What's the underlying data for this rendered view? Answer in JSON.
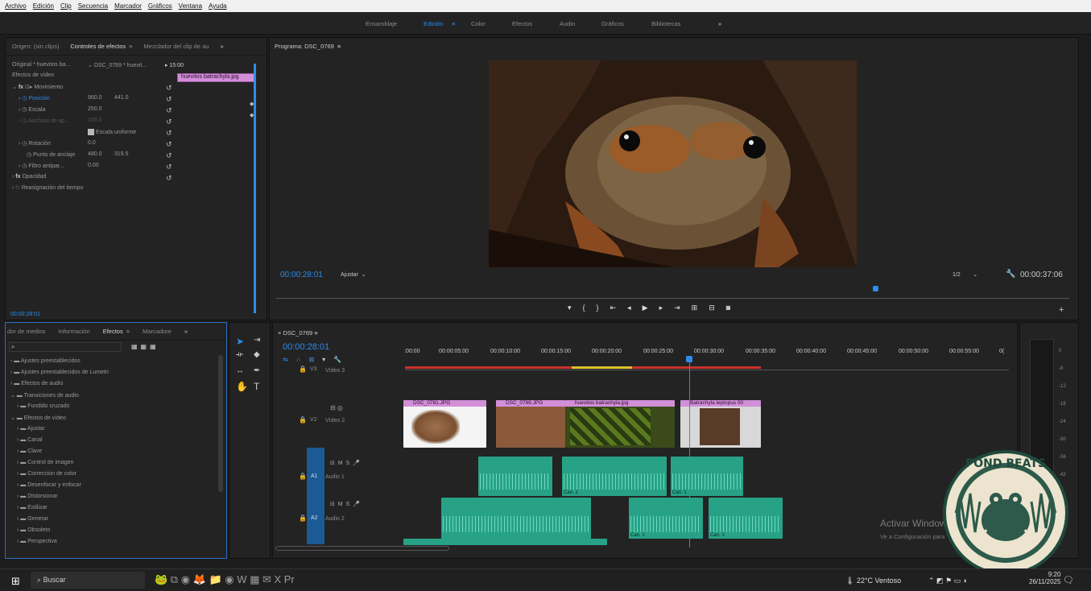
{
  "menubar": {
    "items": [
      "Archivo",
      "Edición",
      "Clip",
      "Secuencia",
      "Marcador",
      "Gráficos",
      "Ventana",
      "Ayuda"
    ]
  },
  "workspaces": {
    "items": [
      "Ensamblaje",
      "Edición",
      "Color",
      "Efectos",
      "Audio",
      "Gráficos",
      "Bibliotecas"
    ],
    "active": "Edición",
    "more": "»"
  },
  "effect_controls": {
    "tabs": [
      "Origen: (sin clips)",
      "Controles de efectos",
      "Mezclador del clip de au"
    ],
    "more": "»",
    "source_label": "Original * huevitos ba...",
    "sequence_label": "DSC_0769 * huevit...",
    "time_head": "15:00",
    "clip_name": "huevitos batrachyla.jpg",
    "section": "Efectos de vídeo",
    "motion": "Movimiento",
    "position_label": "Posición",
    "position_x": "960.0",
    "position_y": "441.0",
    "scale_label": "Escala",
    "scale_value": "250.0",
    "width_label": "Anchura de ap...",
    "width_value": "100.0",
    "uniform_label": "Escala uniforme",
    "rotation_label": "Rotación",
    "rotation_value": "0.0",
    "anchor_label": "Punto de anclaje",
    "anchor_x": "480.0",
    "anchor_y": "319.5",
    "antiflicker_label": "Filtro antipar...",
    "antiflicker_value": "0.00",
    "opacity_label": "Opacidad",
    "timeremap_label": "Reasignación del tiempo",
    "timecode": "00:00:28:01"
  },
  "program": {
    "title": "Programa: DSC_0769",
    "timecode": "00:00:28:01",
    "fit": "Ajustar",
    "resolution": "1/2",
    "duration": "00:00:37:06",
    "playhead_fraction": 0.755
  },
  "effects_panel": {
    "tabs": [
      "dor de medios",
      "Información",
      "Efectos",
      "Marcadore"
    ],
    "more": "»",
    "items": [
      "Ajustes preestablecidos",
      "Ajustes preestablecidos de Lumetri",
      "Efectos de audio",
      "Transiciones de audio",
      "Fundido cruzado",
      "Efectos de vídeo",
      "Ajustar",
      "Canal",
      "Clave",
      "Control de imagen",
      "Corrección de color",
      "Desenfocar y enfocar",
      "Distorsionar",
      "Estilizar",
      "Generar",
      "Obsoleto",
      "Perspectiva"
    ]
  },
  "timeline": {
    "sequence": "DSC_0769",
    "timecode": "00:00:28:01",
    "ruler": [
      ":00:00",
      "00:00:05:00",
      "00:00:10:00",
      "00:00:15:00",
      "00:00:20:00",
      "00:00:25:00",
      "00:00:30:00",
      "00:00:35:00",
      "00:00:40:00",
      "00:00:45:00",
      "00:00:50:00",
      "00:00:55:00",
      "0("
    ],
    "tracks": {
      "v3": "V3",
      "v3_name": "Vídeo 3",
      "v2": "V2",
      "v2_name": "Vídeo 2",
      "a1": "A1",
      "a1_name": "Audio 1",
      "a2": "A2",
      "a2_name": "Audio 2"
    },
    "clips": [
      "DSC_0781.JPG",
      "DSC_0769.JPG",
      "huevitos batrachyla.jpg",
      "Batrachyla leptopus 00"
    ],
    "audio_tag": "Can. 1"
  },
  "meters": {
    "scale": [
      "0",
      "-6",
      "-12",
      "-18",
      "-24",
      "-30",
      "-36",
      "-42"
    ]
  },
  "watermark": {
    "line1": "Activar Windows",
    "line2": "Ve a Configuración para activar Windows."
  },
  "logo": {
    "text": "POND BEATS"
  },
  "taskbar": {
    "search": "Buscar",
    "weather": "22°C  Ventoso",
    "time": "9:20",
    "date": "26/11/2025"
  },
  "colors": {
    "accent": "#2d8ceb",
    "video_clip": "#d28fd8",
    "audio_clip": "#27a286",
    "track_blue": "#1c5a96"
  }
}
